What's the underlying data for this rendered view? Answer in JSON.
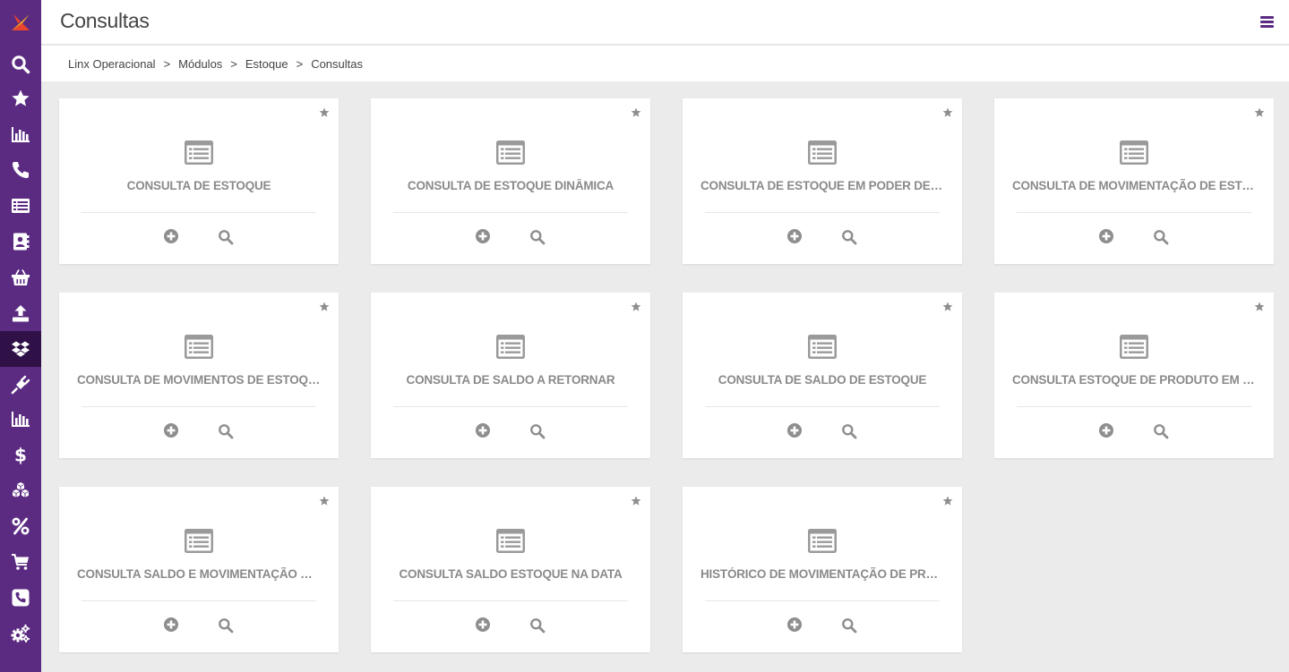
{
  "header": {
    "title": "Consultas"
  },
  "breadcrumb": [
    "Linx Operacional",
    "Módulos",
    "Estoque",
    "Consultas"
  ],
  "sidebar": {
    "items": [
      "search-icon",
      "star-icon",
      "bar-chart-icon",
      "phone-icon",
      "list-icon",
      "contacts-icon",
      "basket-icon",
      "upload-icon",
      "dropbox-icon",
      "plug-icon",
      "bar-chart-icon",
      "dollar-icon",
      "cubes-icon",
      "percent-icon",
      "cart-icon",
      "phone-square-icon",
      "gears-icon"
    ],
    "active_index": 8,
    "colors": {
      "background": "#5b2b82",
      "active": "#2f1148"
    }
  },
  "cards": [
    {
      "title": "CONSULTA DE ESTOQUE"
    },
    {
      "title": "CONSULTA DE ESTOQUE DINÂMICA"
    },
    {
      "title": "CONSULTA DE ESTOQUE EM PODER DE TERC..."
    },
    {
      "title": "CONSULTA DE MOVIMENTAÇÃO DE ESTOQUE ..."
    },
    {
      "title": "CONSULTA DE MOVIMENTOS DE ESTOQUE DE ..."
    },
    {
      "title": "CONSULTA DE SALDO A RETORNAR"
    },
    {
      "title": "CONSULTA DE SALDO DE ESTOQUE"
    },
    {
      "title": "CONSULTA ESTOQUE DE PRODUTO EM PODE..."
    },
    {
      "title": "CONSULTA SALDO E MOVIMENTAÇÃO DE EST..."
    },
    {
      "title": "CONSULTA SALDO ESTOQUE NA DATA"
    },
    {
      "title": "HISTÓRICO DE MOVIMENTAÇÃO DE PRODUTO"
    }
  ]
}
